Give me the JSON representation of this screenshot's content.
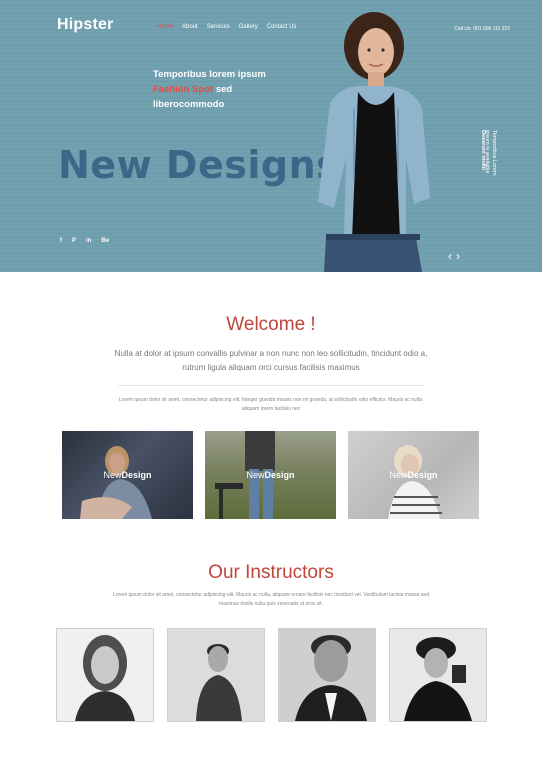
{
  "header": {
    "logo": "Hipster",
    "nav": [
      "Home",
      "About",
      "Services",
      "Gallery",
      "Contact Us"
    ],
    "active_nav": "Home",
    "call": "Call Us: 001 000 111 222"
  },
  "hero": {
    "tagline_line1": "Temporibus lorem ipsum",
    "tagline_highlight": "Fashion Spot",
    "tagline_rest": "sed",
    "tagline_line3": "liberocommodo",
    "headline": "New Designs",
    "social": [
      "f",
      "P",
      "in",
      "Be"
    ],
    "vertical_text": "Temporibus Lorem ipsum is available",
    "vertical_text_2": "Deserunt mollit",
    "arrow_prev": "‹",
    "arrow_next": "›",
    "background_color": "#6f9eae",
    "accent_color": "#d9534f"
  },
  "welcome": {
    "title": "Welcome !",
    "lead": "Nulla at dolor at ipsum convallis pulvinar a non nunc non leo sollicitudin, tincidunt odio a, rutrum ligula aliquam orci cursus facilisis maximus",
    "small": "Lorem ipsum dolor sit amet, consectetur adipiscing elit. Integer gravida mauris non mi gravida, at sollicitudin odio efficitur. Mauris ac nulla, aliquam lorem facilisis nec",
    "gallery": [
      {
        "light": "New",
        "bold": "Design"
      },
      {
        "light": "New",
        "bold": "Design"
      },
      {
        "light": "New",
        "bold": "Design"
      }
    ]
  },
  "instructors": {
    "title": "Our Instructors",
    "small": "Lorem ipsum dolor sit amet, consectetur adipiscing elit. Mauris ac nulla, aliquam ornare facilisis nec tincidunt vel. Vestibulum lacinia massa sed maximus mollis nulla quis venenatis ut eros sit."
  }
}
